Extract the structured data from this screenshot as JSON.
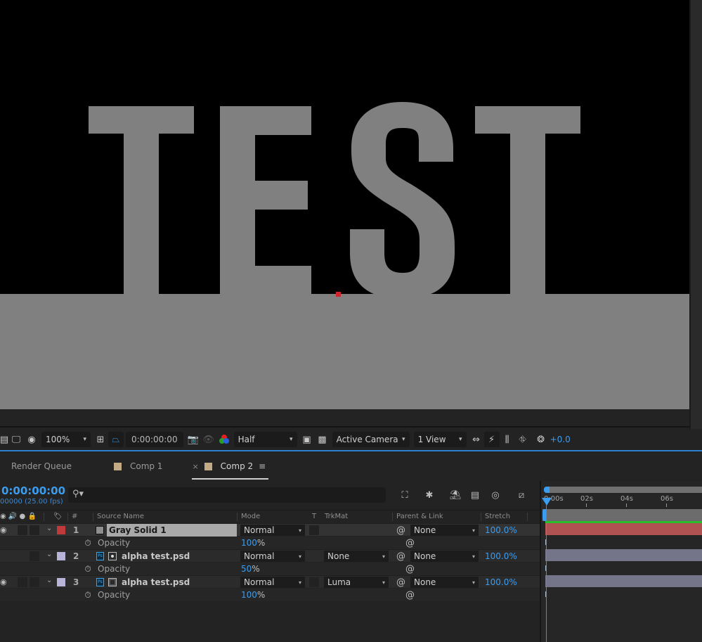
{
  "viewer": {
    "composition_text": "TEST",
    "colors": {
      "background": "#000000",
      "solid": "#808080",
      "anchor": "#d2232a"
    }
  },
  "viewer_toolbar": {
    "zoom": "100%",
    "timecode": "0:00:00:00",
    "resolution": "Half",
    "camera": "Active Camera",
    "views": "1 View",
    "exposure": "+0.0"
  },
  "tabs": [
    {
      "label": "Render Queue",
      "has_swatch": false,
      "active": false
    },
    {
      "label": "Comp 1",
      "has_swatch": true,
      "active": false
    },
    {
      "label": "Comp 2",
      "has_swatch": true,
      "active": true,
      "close": "×",
      "menu": "≡"
    }
  ],
  "timeline": {
    "current_time": "0:00:00:00",
    "frame_info": "00000 (25.00 fps)",
    "search_placeholder": "",
    "columns": {
      "number": "#",
      "source_name": "Source Name",
      "mode": "Mode",
      "t": "T",
      "trkmat": "TrkMat",
      "parent": "Parent & Link",
      "stretch": "Stretch"
    },
    "layers": [
      {
        "index": "1",
        "name": "Gray Solid 1",
        "label_color": "#c0393b",
        "type": "solid",
        "selected": true,
        "mode": "Normal",
        "trkmat": "",
        "parent": "None",
        "stretch": "100.0%",
        "property": {
          "name": "Opacity",
          "value": "100",
          "unit": "%"
        },
        "bar_color": "#b05252"
      },
      {
        "index": "2",
        "name": "alpha test.psd",
        "label_color": "#b8b4d8",
        "type": "psd",
        "selected": false,
        "mode": "Normal",
        "trkmat": "None",
        "parent": "None",
        "stretch": "100.0%",
        "property": {
          "name": "Opacity",
          "value": "50",
          "unit": "%"
        },
        "bar_color": "#75758a"
      },
      {
        "index": "3",
        "name": "alpha test.psd",
        "label_color": "#b8b4d8",
        "type": "psd",
        "selected": false,
        "mode": "Normal",
        "trkmat": "Luma",
        "parent": "None",
        "stretch": "100.0%",
        "property": {
          "name": "Opacity",
          "value": "100",
          "unit": "%"
        },
        "bar_color": "#75758a"
      }
    ],
    "ruler": [
      "0:00s",
      "02s",
      "04s",
      "06s"
    ]
  },
  "icons": {
    "stopwatch": "⏱",
    "spiral": "@",
    "chevron": "⌄",
    "search": "⚲"
  }
}
